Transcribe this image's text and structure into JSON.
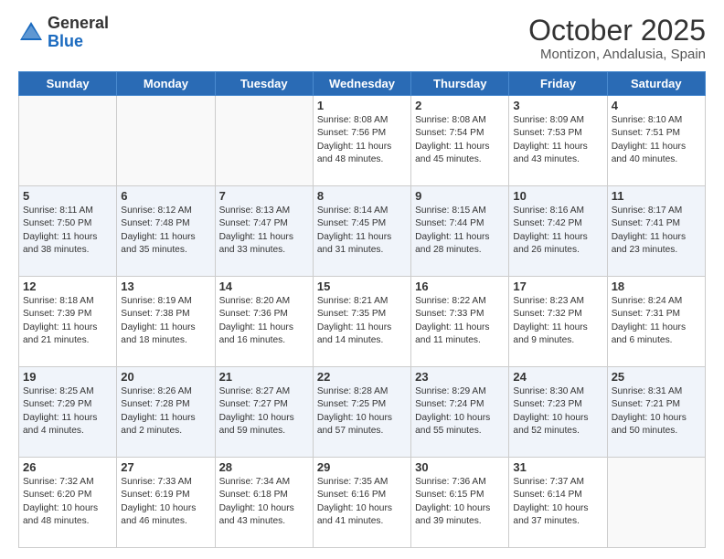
{
  "header": {
    "logo_general": "General",
    "logo_blue": "Blue",
    "title": "October 2025",
    "location": "Montizon, Andalusia, Spain"
  },
  "days_of_week": [
    "Sunday",
    "Monday",
    "Tuesday",
    "Wednesday",
    "Thursday",
    "Friday",
    "Saturday"
  ],
  "weeks": [
    [
      {
        "day": "",
        "info": ""
      },
      {
        "day": "",
        "info": ""
      },
      {
        "day": "",
        "info": ""
      },
      {
        "day": "1",
        "info": "Sunrise: 8:08 AM\nSunset: 7:56 PM\nDaylight: 11 hours and 48 minutes."
      },
      {
        "day": "2",
        "info": "Sunrise: 8:08 AM\nSunset: 7:54 PM\nDaylight: 11 hours and 45 minutes."
      },
      {
        "day": "3",
        "info": "Sunrise: 8:09 AM\nSunset: 7:53 PM\nDaylight: 11 hours and 43 minutes."
      },
      {
        "day": "4",
        "info": "Sunrise: 8:10 AM\nSunset: 7:51 PM\nDaylight: 11 hours and 40 minutes."
      }
    ],
    [
      {
        "day": "5",
        "info": "Sunrise: 8:11 AM\nSunset: 7:50 PM\nDaylight: 11 hours and 38 minutes."
      },
      {
        "day": "6",
        "info": "Sunrise: 8:12 AM\nSunset: 7:48 PM\nDaylight: 11 hours and 35 minutes."
      },
      {
        "day": "7",
        "info": "Sunrise: 8:13 AM\nSunset: 7:47 PM\nDaylight: 11 hours and 33 minutes."
      },
      {
        "day": "8",
        "info": "Sunrise: 8:14 AM\nSunset: 7:45 PM\nDaylight: 11 hours and 31 minutes."
      },
      {
        "day": "9",
        "info": "Sunrise: 8:15 AM\nSunset: 7:44 PM\nDaylight: 11 hours and 28 minutes."
      },
      {
        "day": "10",
        "info": "Sunrise: 8:16 AM\nSunset: 7:42 PM\nDaylight: 11 hours and 26 minutes."
      },
      {
        "day": "11",
        "info": "Sunrise: 8:17 AM\nSunset: 7:41 PM\nDaylight: 11 hours and 23 minutes."
      }
    ],
    [
      {
        "day": "12",
        "info": "Sunrise: 8:18 AM\nSunset: 7:39 PM\nDaylight: 11 hours and 21 minutes."
      },
      {
        "day": "13",
        "info": "Sunrise: 8:19 AM\nSunset: 7:38 PM\nDaylight: 11 hours and 18 minutes."
      },
      {
        "day": "14",
        "info": "Sunrise: 8:20 AM\nSunset: 7:36 PM\nDaylight: 11 hours and 16 minutes."
      },
      {
        "day": "15",
        "info": "Sunrise: 8:21 AM\nSunset: 7:35 PM\nDaylight: 11 hours and 14 minutes."
      },
      {
        "day": "16",
        "info": "Sunrise: 8:22 AM\nSunset: 7:33 PM\nDaylight: 11 hours and 11 minutes."
      },
      {
        "day": "17",
        "info": "Sunrise: 8:23 AM\nSunset: 7:32 PM\nDaylight: 11 hours and 9 minutes."
      },
      {
        "day": "18",
        "info": "Sunrise: 8:24 AM\nSunset: 7:31 PM\nDaylight: 11 hours and 6 minutes."
      }
    ],
    [
      {
        "day": "19",
        "info": "Sunrise: 8:25 AM\nSunset: 7:29 PM\nDaylight: 11 hours and 4 minutes."
      },
      {
        "day": "20",
        "info": "Sunrise: 8:26 AM\nSunset: 7:28 PM\nDaylight: 11 hours and 2 minutes."
      },
      {
        "day": "21",
        "info": "Sunrise: 8:27 AM\nSunset: 7:27 PM\nDaylight: 10 hours and 59 minutes."
      },
      {
        "day": "22",
        "info": "Sunrise: 8:28 AM\nSunset: 7:25 PM\nDaylight: 10 hours and 57 minutes."
      },
      {
        "day": "23",
        "info": "Sunrise: 8:29 AM\nSunset: 7:24 PM\nDaylight: 10 hours and 55 minutes."
      },
      {
        "day": "24",
        "info": "Sunrise: 8:30 AM\nSunset: 7:23 PM\nDaylight: 10 hours and 52 minutes."
      },
      {
        "day": "25",
        "info": "Sunrise: 8:31 AM\nSunset: 7:21 PM\nDaylight: 10 hours and 50 minutes."
      }
    ],
    [
      {
        "day": "26",
        "info": "Sunrise: 7:32 AM\nSunset: 6:20 PM\nDaylight: 10 hours and 48 minutes."
      },
      {
        "day": "27",
        "info": "Sunrise: 7:33 AM\nSunset: 6:19 PM\nDaylight: 10 hours and 46 minutes."
      },
      {
        "day": "28",
        "info": "Sunrise: 7:34 AM\nSunset: 6:18 PM\nDaylight: 10 hours and 43 minutes."
      },
      {
        "day": "29",
        "info": "Sunrise: 7:35 AM\nSunset: 6:16 PM\nDaylight: 10 hours and 41 minutes."
      },
      {
        "day": "30",
        "info": "Sunrise: 7:36 AM\nSunset: 6:15 PM\nDaylight: 10 hours and 39 minutes."
      },
      {
        "day": "31",
        "info": "Sunrise: 7:37 AM\nSunset: 6:14 PM\nDaylight: 10 hours and 37 minutes."
      },
      {
        "day": "",
        "info": ""
      }
    ]
  ]
}
